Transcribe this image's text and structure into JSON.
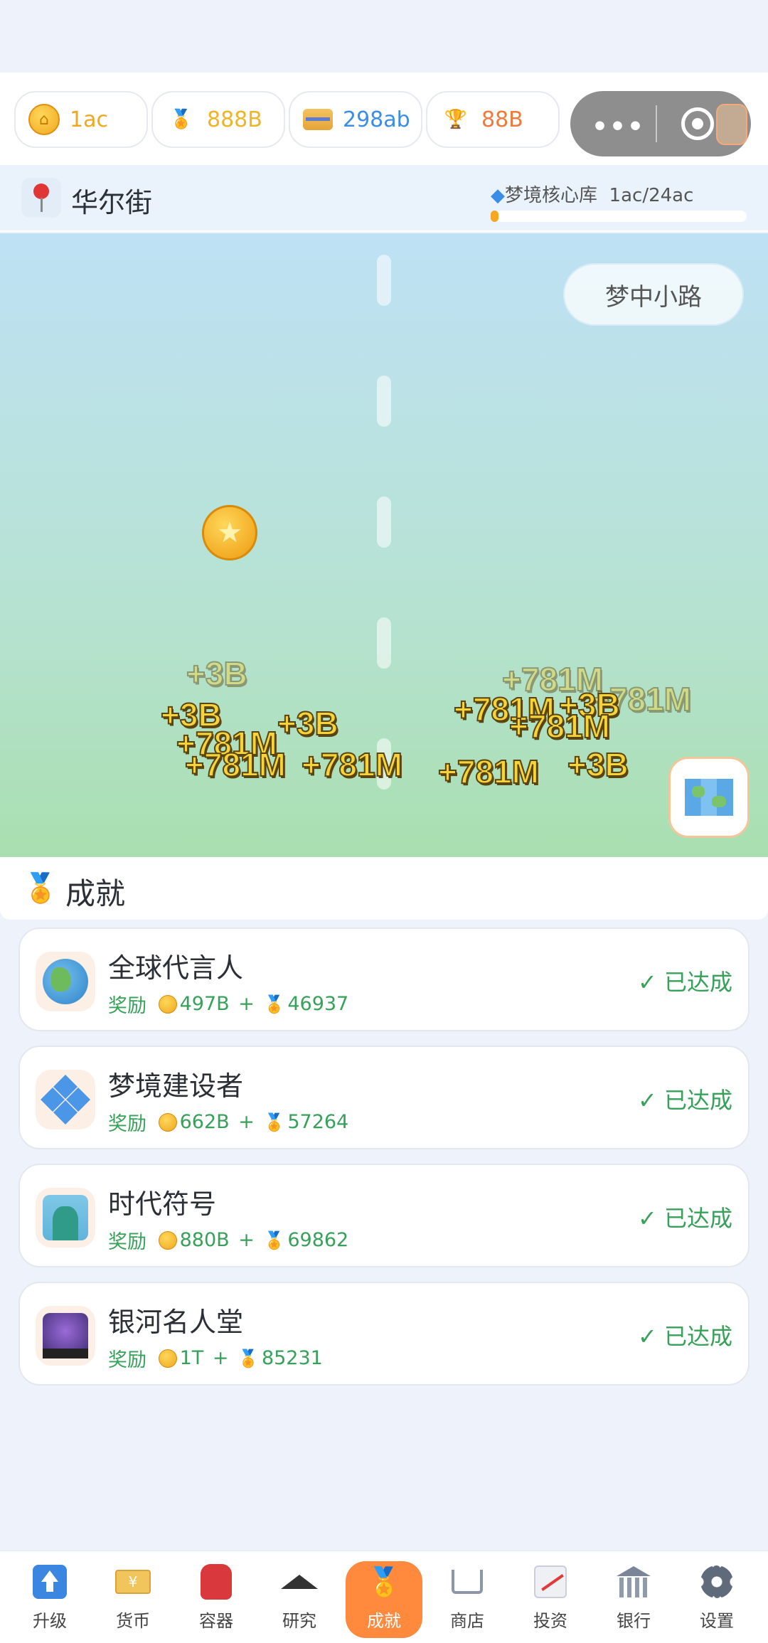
{
  "resources": [
    {
      "value": "1ac",
      "color": "#f0a820",
      "icon": "coin-icon"
    },
    {
      "value": "888B",
      "color": "#f0b428",
      "icon": "medal-icon"
    },
    {
      "value": "298ab",
      "color": "#3a8ee6",
      "icon": "card-icon"
    },
    {
      "value": "88B",
      "color": "#f07a3a",
      "icon": "trophy-icon"
    }
  ],
  "location": {
    "name": "华尔街",
    "core_label": "梦境核心库",
    "core_value": "1ac/24ac",
    "core_progress": 0.03
  },
  "scene": {
    "path_button": "梦中小路",
    "floating": {
      "a": "+3B",
      "b": "+781M"
    }
  },
  "achievements": {
    "title": "成就",
    "reward_label": "奖励",
    "items": [
      {
        "name": "全球代言人",
        "coins": "497B",
        "medals": "46937",
        "status": "已达成",
        "icon": "globe-icon"
      },
      {
        "name": "梦境建设者",
        "coins": "662B",
        "medals": "57264",
        "status": "已达成",
        "icon": "dream-diamond-icon"
      },
      {
        "name": "时代符号",
        "coins": "880B",
        "medals": "69862",
        "status": "已达成",
        "icon": "statue-of-liberty-icon"
      },
      {
        "name": "银河名人堂",
        "coins": "1T",
        "medals": "85231",
        "status": "已达成",
        "icon": "galaxy-icon"
      }
    ]
  },
  "nav": [
    {
      "label": "升级",
      "icon": "upgrade-arrow-icon"
    },
    {
      "label": "货币",
      "icon": "banknote-icon"
    },
    {
      "label": "容器",
      "icon": "backpack-icon"
    },
    {
      "label": "研究",
      "icon": "graduation-cap-icon"
    },
    {
      "label": "成就",
      "icon": "medal-icon",
      "active": true
    },
    {
      "label": "商店",
      "icon": "cart-icon"
    },
    {
      "label": "投资",
      "icon": "chart-icon"
    },
    {
      "label": "银行",
      "icon": "bank-icon"
    },
    {
      "label": "设置",
      "icon": "gear-icon"
    }
  ]
}
